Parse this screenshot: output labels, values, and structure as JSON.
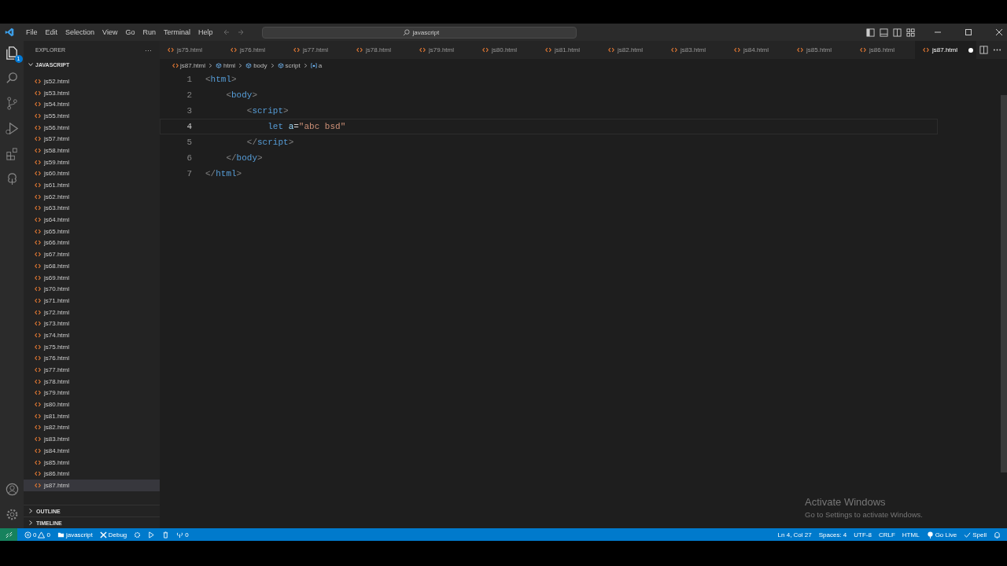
{
  "menu": [
    "File",
    "Edit",
    "Selection",
    "View",
    "Go",
    "Run",
    "Terminal",
    "Help"
  ],
  "search": {
    "value": "javascript"
  },
  "activity_bar": {
    "explorer_badge": "1"
  },
  "sidebar": {
    "title": "EXPLORER",
    "more": "···",
    "folder": "JAVASCRIPT",
    "expanded": true,
    "files": [
      {
        "name": "js52.html",
        "selected": false
      },
      {
        "name": "js53.html",
        "selected": false
      },
      {
        "name": "js54.html",
        "selected": false
      },
      {
        "name": "js55.html",
        "selected": false
      },
      {
        "name": "js56.html",
        "selected": false
      },
      {
        "name": "js57.html",
        "selected": false
      },
      {
        "name": "js58.html",
        "selected": false
      },
      {
        "name": "js59.html",
        "selected": false
      },
      {
        "name": "js60.html",
        "selected": false
      },
      {
        "name": "js61.html",
        "selected": false
      },
      {
        "name": "js62.html",
        "selected": false
      },
      {
        "name": "js63.html",
        "selected": false
      },
      {
        "name": "js64.html",
        "selected": false
      },
      {
        "name": "js65.html",
        "selected": false
      },
      {
        "name": "js66.html",
        "selected": false
      },
      {
        "name": "js67.html",
        "selected": false
      },
      {
        "name": "js68.html",
        "selected": false
      },
      {
        "name": "js69.html",
        "selected": false
      },
      {
        "name": "js70.html",
        "selected": false
      },
      {
        "name": "js71.html",
        "selected": false
      },
      {
        "name": "js72.html",
        "selected": false
      },
      {
        "name": "js73.html",
        "selected": false
      },
      {
        "name": "js74.html",
        "selected": false
      },
      {
        "name": "js75.html",
        "selected": false
      },
      {
        "name": "js76.html",
        "selected": false
      },
      {
        "name": "js77.html",
        "selected": false
      },
      {
        "name": "js78.html",
        "selected": false
      },
      {
        "name": "js79.html",
        "selected": false
      },
      {
        "name": "js80.html",
        "selected": false
      },
      {
        "name": "js81.html",
        "selected": false
      },
      {
        "name": "js82.html",
        "selected": false
      },
      {
        "name": "js83.html",
        "selected": false
      },
      {
        "name": "js84.html",
        "selected": false
      },
      {
        "name": "js85.html",
        "selected": false
      },
      {
        "name": "js86.html",
        "selected": false
      },
      {
        "name": "js87.html",
        "selected": true
      }
    ],
    "sections": [
      {
        "label": "OUTLINE",
        "expanded": false
      },
      {
        "label": "TIMELINE",
        "expanded": false
      }
    ]
  },
  "tabs": [
    {
      "label": "js75.html",
      "selected": false,
      "dirty": false
    },
    {
      "label": "js76.html",
      "selected": false,
      "dirty": false
    },
    {
      "label": "js77.html",
      "selected": false,
      "dirty": false
    },
    {
      "label": "js78.html",
      "selected": false,
      "dirty": false
    },
    {
      "label": "js79.html",
      "selected": false,
      "dirty": false
    },
    {
      "label": "js80.html",
      "selected": false,
      "dirty": false
    },
    {
      "label": "js81.html",
      "selected": false,
      "dirty": false
    },
    {
      "label": "js82.html",
      "selected": false,
      "dirty": false
    },
    {
      "label": "js83.html",
      "selected": false,
      "dirty": false
    },
    {
      "label": "js84.html",
      "selected": false,
      "dirty": false
    },
    {
      "label": "js85.html",
      "selected": false,
      "dirty": false
    },
    {
      "label": "js86.html",
      "selected": false,
      "dirty": false
    },
    {
      "label": "js87.html",
      "selected": true,
      "dirty": true
    }
  ],
  "breadcrumb": [
    {
      "label": "js87.html",
      "kind": "file"
    },
    {
      "label": "html",
      "kind": "element"
    },
    {
      "label": "body",
      "kind": "element"
    },
    {
      "label": "script",
      "kind": "element"
    },
    {
      "label": "a",
      "kind": "variable"
    }
  ],
  "editor": {
    "lines": [
      {
        "number": "1",
        "selected": false,
        "tokens": [
          {
            "text": "<",
            "kind": "punct"
          },
          {
            "text": "html",
            "kind": "tag"
          },
          {
            "text": ">",
            "kind": "punct"
          }
        ]
      },
      {
        "number": "2",
        "selected": false,
        "tokens": [
          {
            "text": "    <",
            "kind": "punct"
          },
          {
            "text": "body",
            "kind": "tag"
          },
          {
            "text": ">",
            "kind": "punct"
          }
        ]
      },
      {
        "number": "3",
        "selected": false,
        "tokens": [
          {
            "text": "        <",
            "kind": "punct"
          },
          {
            "text": "script",
            "kind": "tag"
          },
          {
            "text": ">",
            "kind": "punct"
          }
        ]
      },
      {
        "number": "4",
        "selected": true,
        "tokens": [
          {
            "text": "            let",
            "kind": "keyword"
          },
          {
            "text": " a",
            "kind": "var"
          },
          {
            "text": "=",
            "kind": "op"
          },
          {
            "text": "\"abc bsd",
            "kind": "string"
          },
          {
            "text": "\"",
            "kind": "string"
          }
        ]
      },
      {
        "number": "5",
        "selected": false,
        "tokens": [
          {
            "text": "        </",
            "kind": "punct"
          },
          {
            "text": "script",
            "kind": "tag"
          },
          {
            "text": ">",
            "kind": "punct"
          }
        ]
      },
      {
        "number": "6",
        "selected": false,
        "tokens": [
          {
            "text": "    </",
            "kind": "punct"
          },
          {
            "text": "body",
            "kind": "tag"
          },
          {
            "text": ">",
            "kind": "punct"
          }
        ]
      },
      {
        "number": "7",
        "selected": false,
        "tokens": [
          {
            "text": "</",
            "kind": "punct"
          },
          {
            "text": "html",
            "kind": "tag"
          },
          {
            "text": ">",
            "kind": "punct"
          }
        ]
      }
    ]
  },
  "activation": {
    "title": "Activate Windows",
    "subtitle": "Go to Settings to activate Windows."
  },
  "status_bar": {
    "errors": "0",
    "warnings": "0",
    "folder": "javascript",
    "debug": "Debug",
    "ports": "0",
    "right": [
      "Ln 4, Col 27",
      "Spaces: 4",
      "UTF-8",
      "CRLF",
      "HTML"
    ],
    "go_live": "Go Live",
    "spell": "Spell"
  }
}
